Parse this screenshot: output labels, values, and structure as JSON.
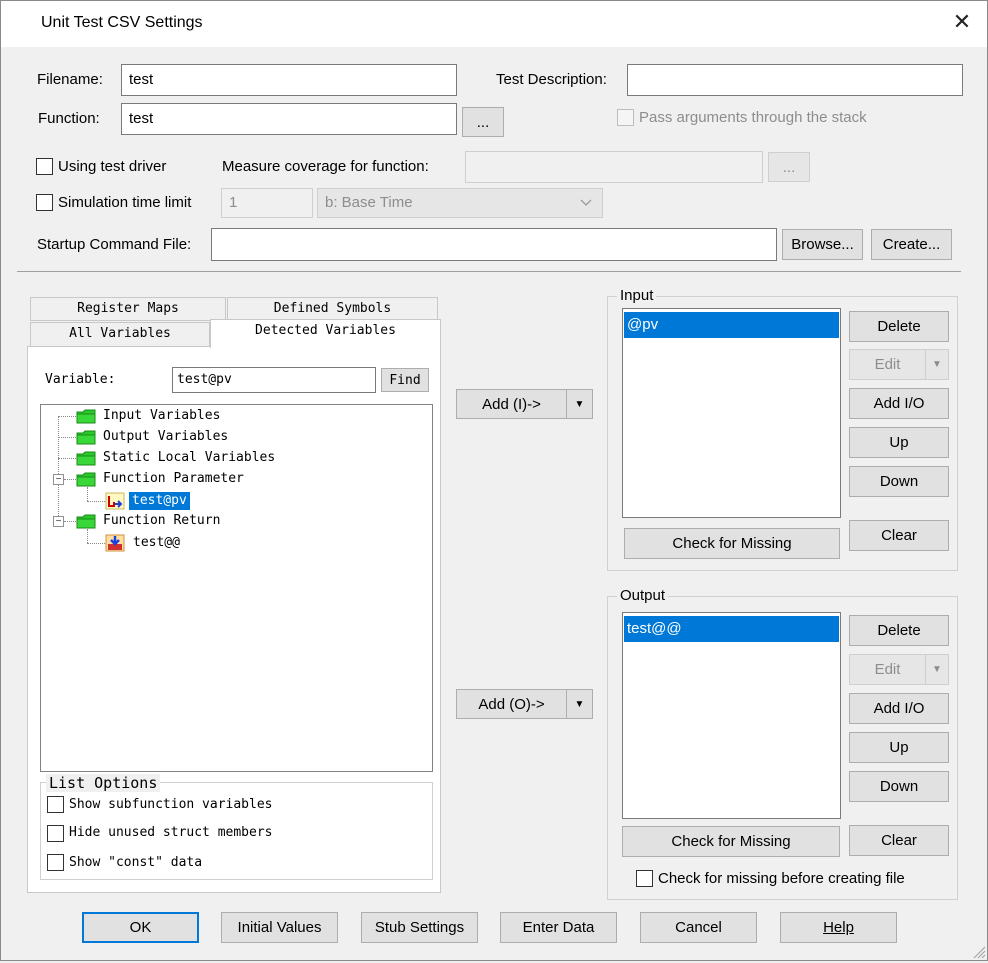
{
  "window": {
    "title": "Unit Test CSV Settings"
  },
  "fields": {
    "filename_label": "Filename:",
    "filename_value": "test",
    "function_label": "Function:",
    "function_value": "test",
    "function_browse": "...",
    "test_description_label": "Test Description:",
    "test_description_value": "",
    "pass_args_label": "Pass arguments through the stack",
    "using_test_driver_label": "Using test driver",
    "measure_coverage_label": "Measure coverage for function:",
    "measure_coverage_value": "",
    "coverage_browse": "...",
    "sim_time_limit_label": "Simulation time limit",
    "sim_time_value": "1",
    "time_base_value": "b: Base Time",
    "startup_label": "Startup Command File:",
    "startup_value": "",
    "browse_label": "Browse...",
    "create_label": "Create..."
  },
  "tabs": {
    "register_maps": "Register Maps",
    "defined_symbols": "Defined Symbols",
    "all_variables": "All Variables",
    "detected_variables": "Detected Variables"
  },
  "variable": {
    "label": "Variable:",
    "value": "test@pv",
    "find_label": "Find"
  },
  "tree": {
    "input_variables": "Input Variables",
    "output_variables": "Output Variables",
    "static_local_variables": "Static Local Variables",
    "function_parameter": "Function Parameter",
    "param_item": "test@pv",
    "function_return": "Function Return",
    "return_item": "test@@"
  },
  "list_options": {
    "title": "List Options",
    "show_subfunction": "Show subfunction variables",
    "hide_unused": "Hide unused struct members",
    "show_const": "Show \"const\" data"
  },
  "add": {
    "input_label": "Add (I)->",
    "output_label": "Add (O)->"
  },
  "input_group": {
    "title": "Input",
    "items": [
      "@pv"
    ],
    "delete": "Delete",
    "edit": "Edit",
    "add_io": "Add I/O",
    "up": "Up",
    "down": "Down",
    "clear": "Clear",
    "check_missing": "Check for Missing"
  },
  "output_group": {
    "title": "Output",
    "items": [
      "test@@"
    ],
    "delete": "Delete",
    "edit": "Edit",
    "add_io": "Add I/O",
    "up": "Up",
    "down": "Down",
    "clear": "Clear",
    "check_missing": "Check for Missing",
    "check_before_label": "Check for missing before creating file"
  },
  "footer": {
    "ok": "OK",
    "initial_values": "Initial Values",
    "stub_settings": "Stub Settings",
    "enter_data": "Enter Data",
    "cancel": "Cancel",
    "help": "Help"
  }
}
